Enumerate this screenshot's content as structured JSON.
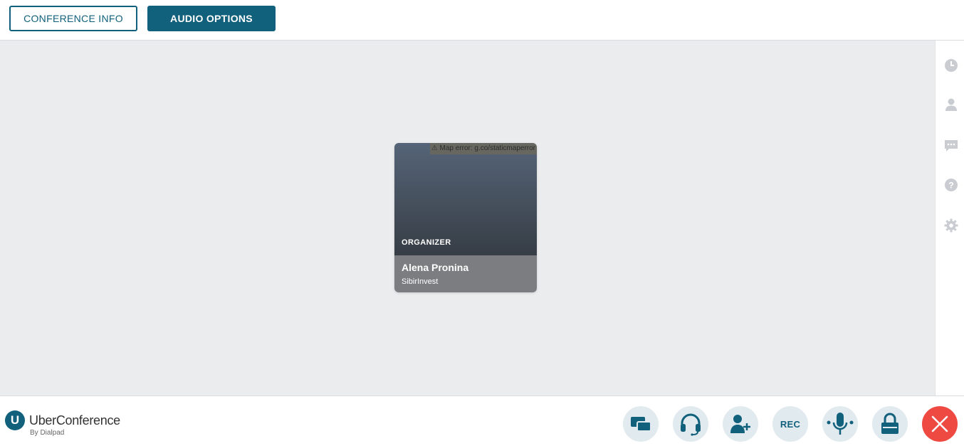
{
  "header": {
    "conference_info_label": "CONFERENCE INFO",
    "audio_options_label": "AUDIO OPTIONS"
  },
  "participant": {
    "map_error": "⚠ Map error: g.co/staticmaperror",
    "role": "ORGANIZER",
    "name": "Alena Pronina",
    "company": "SibirInvest"
  },
  "sidebar": {
    "items": [
      {
        "icon": "clock-icon"
      },
      {
        "icon": "person-icon"
      },
      {
        "icon": "chat-icon"
      },
      {
        "icon": "help-icon"
      },
      {
        "icon": "gear-icon"
      }
    ]
  },
  "brand": {
    "logo_letter": "U",
    "name": "UberConference",
    "sub": "By Dialpad"
  },
  "controls": {
    "rec_label": "REC",
    "items": [
      "screenshare-icon",
      "headset-icon",
      "add-person-icon",
      "rec",
      "microphone-icon",
      "lock-icon",
      "close-icon"
    ]
  },
  "colors": {
    "accent": "#11607c",
    "stage_bg": "#ebecee",
    "end_call": "#ef4a42",
    "sidebar_icon": "#c9cdd1"
  }
}
